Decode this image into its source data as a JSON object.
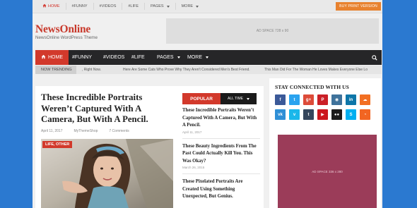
{
  "topbar": {
    "items": [
      {
        "label": "HOME",
        "icon": "home-icon"
      },
      {
        "label": "#FUNNY"
      },
      {
        "label": "#VIDEOS"
      },
      {
        "label": "#LIFE"
      },
      {
        "label": "PAGES",
        "dropdown": true
      },
      {
        "label": "MORE",
        "dropdown": true
      }
    ],
    "buy_button": "BUY PRINT VERSION"
  },
  "header": {
    "logo": "NewsOnline",
    "tagline": "NewsOnline WordPress Theme",
    "ad": "AD SPACE 728 x 90"
  },
  "mainnav": {
    "home": "HOME",
    "items": [
      "#FUNNY",
      "#VIDEOS",
      "#LIFE",
      "PAGES",
      "MORE"
    ],
    "search_icon": "search-icon"
  },
  "trending": {
    "label": "NOW TRENDING",
    "items": [
      ", Right Now.",
      "Here Are Some Cats Who Prove Why They Aren't Considered Men's Best Friend.",
      "This Man Did For The Woman He Loves Makes Everyone Else Lo"
    ]
  },
  "article": {
    "title": "These Incredible Portraits Weren’t Captured With A Camera, But With A Pencil.",
    "date": "April 11, 2017",
    "author": "MyThemeShop",
    "comments": "7 Comments",
    "category": "LIFE, OTHER"
  },
  "popular": {
    "tab_popular": "POPULAR",
    "tab_alltime": "ALL TIME",
    "items": [
      {
        "title": "These Incredible Portraits Weren’t Captured With A Camera, But With A Pencil.",
        "date": "April 11, 2017"
      },
      {
        "title": "These Beauty Ingredients From The Past Could Actually Kill You. This Was Okay?",
        "date": "March 26, 2015"
      },
      {
        "title": "These Pixelated Portraits Are Created Using Something Unexpected, But Genius.",
        "date": ""
      }
    ]
  },
  "sidebar": {
    "heading": "STAY CONNECTED WITH US",
    "social": [
      {
        "name": "facebook-icon",
        "glyph": "f",
        "color": "#3b5998"
      },
      {
        "name": "twitter-icon",
        "glyph": "t",
        "color": "#2aa3ef"
      },
      {
        "name": "google-plus-icon",
        "glyph": "g+",
        "color": "#dd4b39"
      },
      {
        "name": "pinterest-icon",
        "glyph": "P",
        "color": "#cb2027"
      },
      {
        "name": "instagram-icon",
        "glyph": "◉",
        "color": "#3f729b"
      },
      {
        "name": "linkedin-icon",
        "glyph": "in",
        "color": "#0e76a8"
      },
      {
        "name": "soundcloud-icon",
        "glyph": "☁",
        "color": "#f26f23"
      },
      {
        "name": "vk-icon",
        "glyph": "vk",
        "color": "#2f8fd6"
      },
      {
        "name": "vimeo-icon",
        "glyph": "v",
        "color": "#1ab7ea"
      },
      {
        "name": "tumblr-icon",
        "glyph": "t",
        "color": "#35465c"
      },
      {
        "name": "youtube-icon",
        "glyph": "▶",
        "color": "#cc181e"
      },
      {
        "name": "flickr-icon",
        "glyph": "●●",
        "color": "#1c1c1c"
      },
      {
        "name": "skype-icon",
        "glyph": "S",
        "color": "#00aff0"
      },
      {
        "name": "rss-icon",
        "glyph": "◔",
        "color": "#f26522"
      }
    ],
    "ad": "AD SPACE 336 x 280"
  }
}
